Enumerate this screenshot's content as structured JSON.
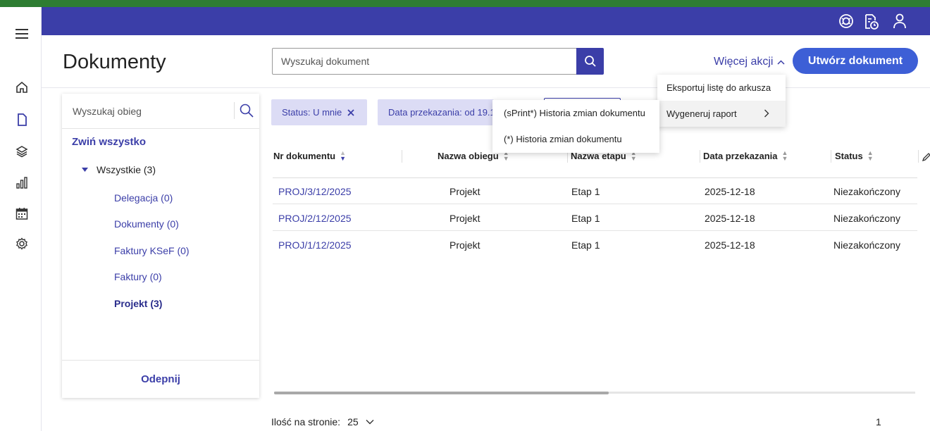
{
  "header": {
    "page_title": "Dokumenty",
    "search_placeholder": "Wyszukaj dokument",
    "more_actions_label": "Więcej akcji",
    "create_button_label": "Utwórz dokument",
    "icons": [
      "support-icon",
      "document-clock-icon",
      "user-icon"
    ]
  },
  "nav": {
    "icons": [
      "menu-icon",
      "home-icon",
      "document-icon",
      "layers-icon",
      "chart-icon",
      "calendar-icon",
      "settings-icon"
    ]
  },
  "sidebar": {
    "search_placeholder": "Wyszukaj obieg",
    "collapse_all_label": "Zwiń wszystko",
    "root_label": "Wszystkie (3)",
    "items": [
      {
        "label": "Delegacja (0)"
      },
      {
        "label": "Dokumenty (0)"
      },
      {
        "label": "Faktury KSeF (0)"
      },
      {
        "label": "Faktury (0)"
      },
      {
        "label": "Projekt (3)"
      }
    ],
    "footer_label": "Odepnij"
  },
  "filters": {
    "status_chip": "Status: U mnie",
    "date_chip": "Data przekazania: od 19.1"
  },
  "table": {
    "columns": [
      "Nr dokumentu",
      "Nazwa obiegu",
      "Nazwa etapu",
      "Data przekazania",
      "Status"
    ],
    "rows": [
      {
        "nr": "PROJ/3/12/2025",
        "obieg": "Projekt",
        "etap": "Etap 1",
        "data": "2025-12-18",
        "status": "Niezakończony"
      },
      {
        "nr": "PROJ/2/12/2025",
        "obieg": "Projekt",
        "etap": "Etap 1",
        "data": "2025-12-18",
        "status": "Niezakończony"
      },
      {
        "nr": "PROJ/1/12/2025",
        "obieg": "Projekt",
        "etap": "Etap 1",
        "data": "2025-12-18",
        "status": "Niezakończony"
      }
    ]
  },
  "pagination": {
    "per_page_label": "Ilość na stronie:",
    "per_page_value": "25",
    "current_page": "1"
  },
  "menu": {
    "items": [
      {
        "label": "Eksportuj listę do arkusza"
      },
      {
        "label": "Wygeneruj raport"
      }
    ],
    "submenu": [
      {
        "label": "(sPrint*) Historia zmian dokumentu"
      },
      {
        "label": "(*) Historia zmian dokumentu"
      }
    ]
  },
  "colors": {
    "primary": "#3b3ea8",
    "accent_button": "#3d5fd6",
    "chip_background": "#dcdcf5",
    "top_strip": "#2e7d32"
  }
}
